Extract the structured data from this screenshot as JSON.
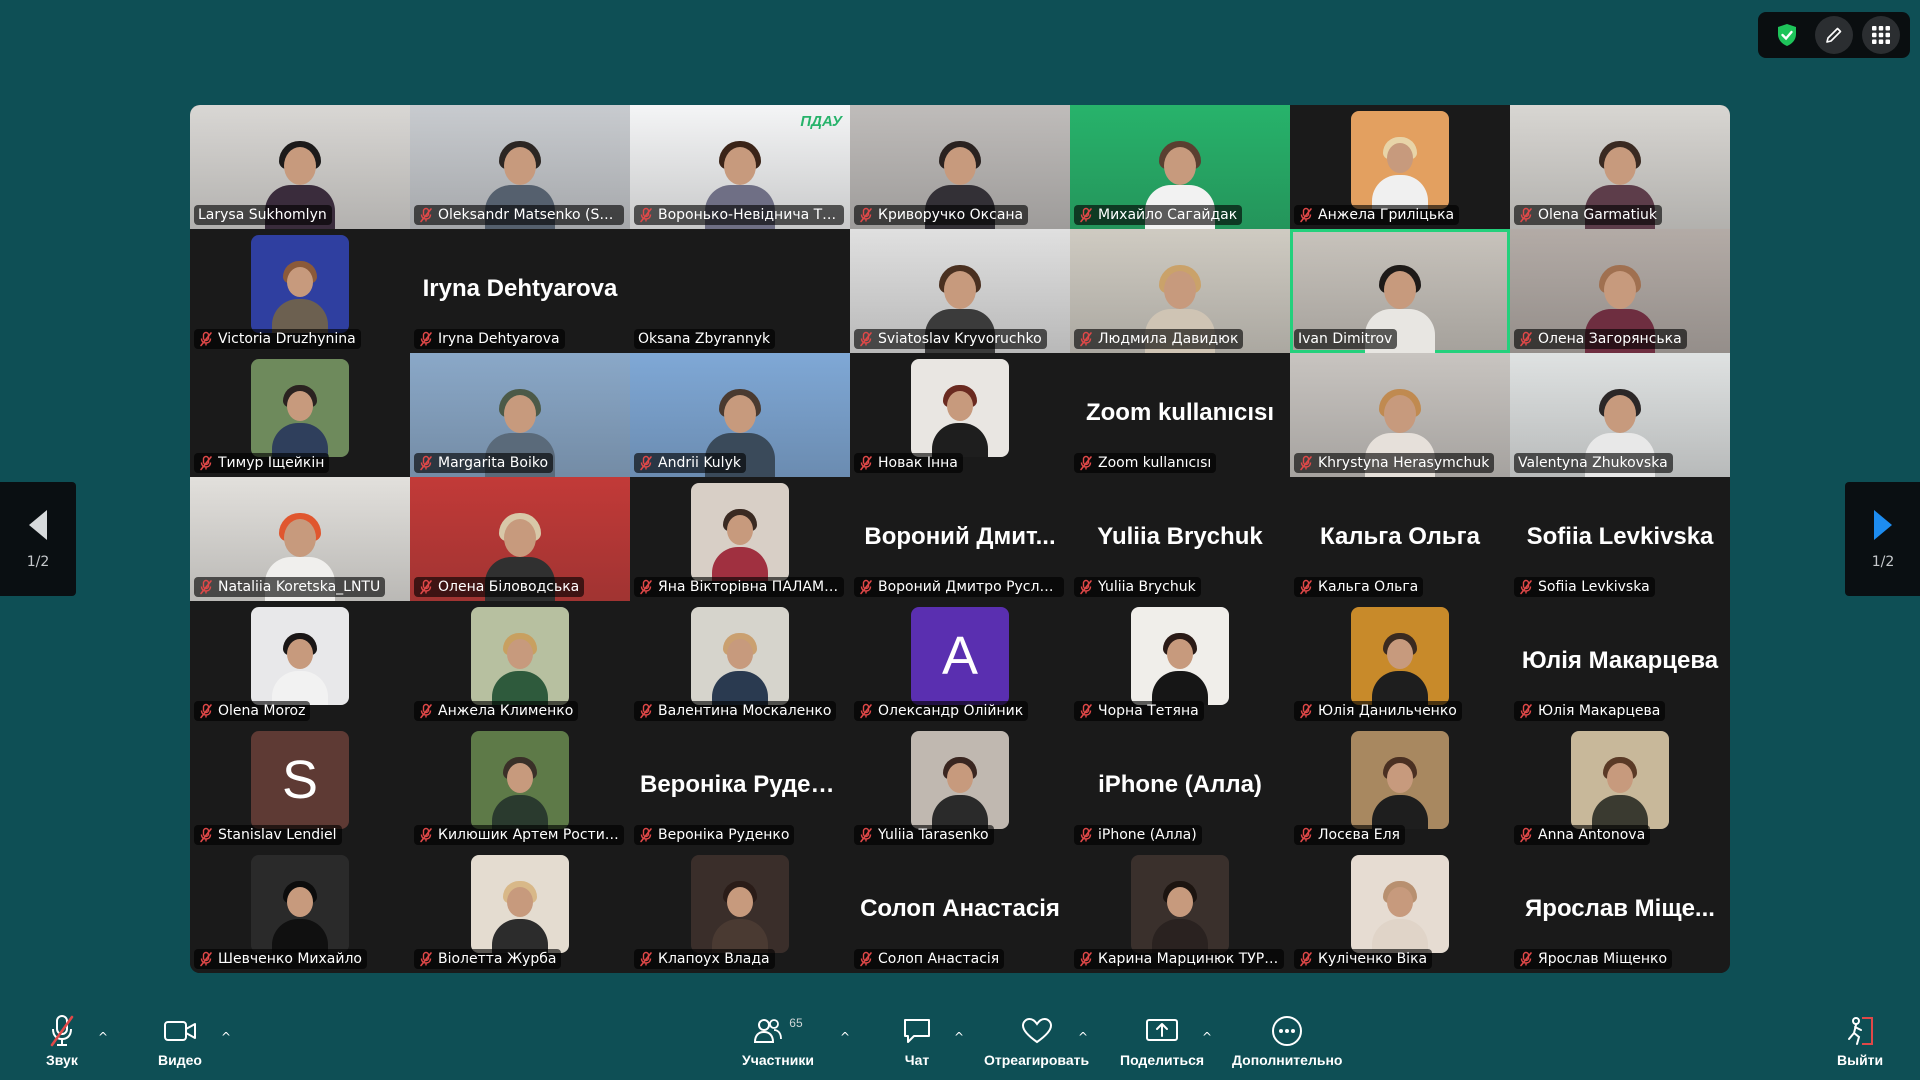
{
  "colors": {
    "background": "#0e4f55",
    "grid": "#1a1a1a",
    "active_speaker": "#24d07c",
    "muted_icon": "#e04848",
    "accent_blue": "#1d8cf0"
  },
  "top_tools": [
    {
      "icon": "shield-check-icon"
    },
    {
      "icon": "pencil-icon"
    },
    {
      "icon": "apps-grid-icon"
    }
  ],
  "pager": {
    "left": "1/2",
    "right": "1/2"
  },
  "participants": [
    {
      "name": "Larysa Sukhomlyn",
      "muted": false,
      "kind": "video",
      "bg": "#d9d7d4",
      "hair": "#1c1a1a",
      "shirt": "#3a2c3c"
    },
    {
      "name": "Oleksandr Matsenko (Su...",
      "muted": true,
      "kind": "video",
      "bg": "#c8cbcf",
      "hair": "#2c2623",
      "shirt": "#55606e"
    },
    {
      "name": "Воронько-Невіднича Тет...",
      "muted": true,
      "kind": "video",
      "bg": "#f4f5f6",
      "hair": "#3b2418",
      "shirt": "#6f6f85",
      "logo": "ПДАУ"
    },
    {
      "name": "Криворучко Оксана",
      "muted": true,
      "kind": "video",
      "bg": "#bfbcba",
      "hair": "#2a2220",
      "shirt": "#333036"
    },
    {
      "name": "Михайло Сагайдак",
      "muted": true,
      "kind": "video",
      "bg": "#27b36b",
      "hair": "#5a3f30",
      "shirt": "#f2f2f2"
    },
    {
      "name": "Анжела Гриліцька",
      "muted": true,
      "kind": "avatar",
      "bg": "#e3a060",
      "hair": "#e8d4a8",
      "shirt": "#f0f0f0"
    },
    {
      "name": "Olena Garmatiuk",
      "muted": true,
      "kind": "video",
      "bg": "#d8d6d2",
      "hair": "#3a2a22",
      "shirt": "#5d3d4a"
    },
    {
      "name": "Victoria Druzhynina",
      "muted": true,
      "kind": "avatar",
      "bg": "#2f3fa0",
      "hair": "#8b5a3a",
      "shirt": "#6c6050"
    },
    {
      "name": "Iryna Dehtyarova",
      "muted": true,
      "kind": "text",
      "big": "Iryna Dehtyarova"
    },
    {
      "name": "Oksana Zbyrannyk",
      "muted": false,
      "kind": "empty"
    },
    {
      "name": "Sviatoslav Kryvoruchko",
      "muted": true,
      "kind": "video",
      "bg": "#e0e0e0",
      "hair": "#4a3020",
      "shirt": "#3b3b3b"
    },
    {
      "name": "Людмила Давидюк",
      "muted": true,
      "kind": "video",
      "bg": "#cfcbc2",
      "hair": "#caa26a",
      "shirt": "#cfc4b4"
    },
    {
      "name": "Ivan Dimitrov",
      "muted": false,
      "kind": "video",
      "bg": "#c8c3bc",
      "hair": "#1e1a18",
      "shirt": "#e8e6e2",
      "active": true
    },
    {
      "name": "Олена Загорянська",
      "muted": true,
      "kind": "video",
      "bg": "#b3aba6",
      "hair": "#a07050",
      "shirt": "#6e2e40"
    },
    {
      "name": "Тимур Іщейкін",
      "muted": true,
      "kind": "avatar",
      "bg": "#6e8a5c",
      "hair": "#2a2220",
      "shirt": "#2f3f5c"
    },
    {
      "name": "Margarita Boiko",
      "muted": true,
      "kind": "video",
      "bg": "#8aa8c8",
      "hair": "#4c5a48",
      "shirt": "#5a6a7a"
    },
    {
      "name": "Andrii Kulyk",
      "muted": true,
      "kind": "video",
      "bg": "#7fa8d6",
      "hair": "#4a3a30",
      "shirt": "#3a4a5a"
    },
    {
      "name": "Новак Інна",
      "muted": true,
      "kind": "avatar",
      "bg": "#e9e6e2",
      "hair": "#6a2a20",
      "shirt": "#1e1e1e"
    },
    {
      "name": "Zoom kullanıcısı",
      "muted": true,
      "kind": "text",
      "big": "Zoom kullanıcısı"
    },
    {
      "name": "Khrystyna Herasymchuk",
      "muted": true,
      "kind": "video",
      "bg": "#c8c4c0",
      "hair": "#c08a50",
      "shirt": "#e6e0da"
    },
    {
      "name": "Valentyna Zhukovska",
      "muted": false,
      "kind": "video",
      "bg": "#dfe2e2",
      "hair": "#2b2727",
      "shirt": "#e8e8e8"
    },
    {
      "name": "Nataliia Koretska_LNTU",
      "muted": true,
      "kind": "video",
      "bg": "#e2e0dc",
      "hair": "#e0562e",
      "shirt": "#f0efed"
    },
    {
      "name": "Олена Біловодська",
      "muted": true,
      "kind": "video",
      "bg": "#c23a38",
      "hair": "#d8c8a8",
      "shirt": "#303030"
    },
    {
      "name": "Яна Вікторівна ПАЛАМА...",
      "muted": true,
      "kind": "avatar",
      "bg": "#d8cfc6",
      "hair": "#3a2a22",
      "shirt": "#a03040"
    },
    {
      "name": "Вороний Дмитро Руслан...",
      "muted": true,
      "kind": "text",
      "big": "Вороний Дмит..."
    },
    {
      "name": "Yuliia Brychuk",
      "muted": true,
      "kind": "text",
      "big": "Yuliia Brychuk"
    },
    {
      "name": "Кальга Ольга",
      "muted": true,
      "kind": "text",
      "big": "Кальга Ольга"
    },
    {
      "name": "Sofiia Levkivska",
      "muted": true,
      "kind": "text",
      "big": "Sofiia Levkivska"
    },
    {
      "name": "Olena Moroz",
      "muted": true,
      "kind": "avatar",
      "bg": "#e8e8ea",
      "hair": "#1a1616",
      "shirt": "#f2f2f2"
    },
    {
      "name": "Анжела Клименко",
      "muted": true,
      "kind": "avatar",
      "bg": "#b7c0a0",
      "hair": "#c8a060",
      "shirt": "#2e5a3c"
    },
    {
      "name": "Валентина Москаленко",
      "muted": true,
      "kind": "avatar",
      "bg": "#d6d4cc",
      "hair": "#caa070",
      "shirt": "#2a3a50"
    },
    {
      "name": "Олександр Олійник",
      "muted": true,
      "kind": "letter",
      "letter": "A",
      "bg": "#5a2fb0"
    },
    {
      "name": "Чорна Тетяна",
      "muted": true,
      "kind": "avatar",
      "bg": "#f0eeea",
      "hair": "#2a1a16",
      "shirt": "#161616"
    },
    {
      "name": "Юлія Данильченко",
      "muted": true,
      "kind": "avatar",
      "bg": "#c88a2a",
      "hair": "#3a2a20",
      "shirt": "#1e1e1e"
    },
    {
      "name": "Юлія Макарцева",
      "muted": true,
      "kind": "text",
      "big": "Юлія Макарцева"
    },
    {
      "name": "Stanislav Lendiel",
      "muted": true,
      "kind": "letter",
      "letter": "S",
      "bg": "#5e3a34"
    },
    {
      "name": "Килюшик Артем Ростисл...",
      "muted": true,
      "kind": "avatar",
      "bg": "#5e7a48",
      "hair": "#3a3028",
      "shirt": "#2a3a2e"
    },
    {
      "name": "Вероніка Руденко",
      "muted": true,
      "kind": "text",
      "big": "Вероніка Руден..."
    },
    {
      "name": "Yuliia Tarasenko",
      "muted": true,
      "kind": "avatar",
      "bg": "#c0b8b0",
      "hair": "#3a2620",
      "shirt": "#2a2a2a"
    },
    {
      "name": "iPhone (Алла)",
      "muted": true,
      "kind": "text",
      "big": "iPhone (Алла)"
    },
    {
      "name": "Лосєва Еля",
      "muted": true,
      "kind": "avatar",
      "bg": "#a88860",
      "hair": "#4a3022",
      "shirt": "#1e1e1e"
    },
    {
      "name": "Anna Antonova",
      "muted": true,
      "kind": "avatar",
      "bg": "#c8b89a",
      "hair": "#5a3a26",
      "shirt": "#3a3a30"
    },
    {
      "name": "Шевченко Михайло",
      "muted": true,
      "kind": "avatar",
      "bg": "#2a2a2a",
      "hair": "#0c0c0c",
      "shirt": "#101010"
    },
    {
      "name": "Віолетта Журба",
      "muted": true,
      "kind": "avatar",
      "bg": "#e4dcd0",
      "hair": "#d8b888",
      "shirt": "#2c2c2c"
    },
    {
      "name": "Клапоух Влада",
      "muted": true,
      "kind": "avatar",
      "bg": "#3a2e2a",
      "hair": "#2a1c18",
      "shirt": "#4a3a32"
    },
    {
      "name": "Солоп Анастасія",
      "muted": true,
      "kind": "text",
      "big": "Солоп Анастасія"
    },
    {
      "name": "Карина Марцинюк ТУР 3...",
      "muted": true,
      "kind": "avatar",
      "bg": "#3a302c",
      "hair": "#1c1410",
      "shirt": "#2a2220"
    },
    {
      "name": "Куліченко Віка",
      "muted": true,
      "kind": "avatar",
      "bg": "#e6dcd2",
      "hair": "#b89070",
      "shirt": "#e0d4c8"
    },
    {
      "name": "Ярослав Міщенко",
      "muted": true,
      "kind": "text",
      "big": "Ярослав Міще..."
    }
  ],
  "toolbar": {
    "audio": {
      "label": "Звук",
      "icon": "microphone-muted-icon"
    },
    "video": {
      "label": "Видео",
      "icon": "camera-icon"
    },
    "participants": {
      "label": "Участники",
      "count": "65",
      "icon": "participants-icon"
    },
    "chat": {
      "label": "Чат",
      "icon": "chat-bubble-icon"
    },
    "react": {
      "label": "Отреагировать",
      "icon": "heart-icon"
    },
    "share": {
      "label": "Поделиться",
      "icon": "share-screen-icon"
    },
    "more": {
      "label": "Дополнительно",
      "icon": "more-icon"
    },
    "leave": {
      "label": "Выйти",
      "icon": "leave-icon"
    }
  }
}
